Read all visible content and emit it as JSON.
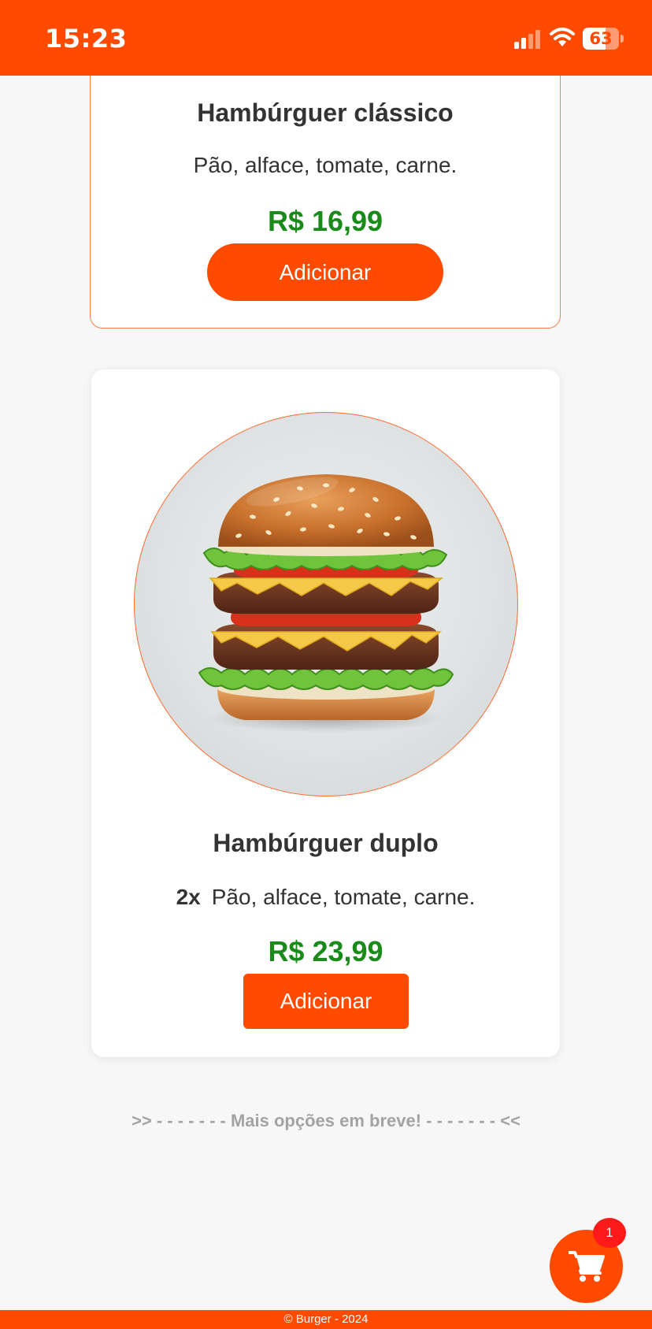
{
  "status_bar": {
    "time": "15:23",
    "battery_level": "63",
    "battery_fraction": 0.63,
    "signal_bars_filled": 2,
    "signal_bars_total": 4,
    "background_color": "#ff4a00"
  },
  "products": [
    {
      "title": "Hambúrguer clássico",
      "description": "Pão, alface, tomate, carne.",
      "price": "R$ 16,99",
      "add_label": "Adicionar"
    },
    {
      "title": "Hambúrguer duplo",
      "quantity": "2x",
      "description": "Pão, alface, tomate, carne.",
      "price": "R$ 23,99",
      "add_label": "Adicionar"
    }
  ],
  "more_options_text": ">> - - - - - - - Mais opções em breve! - - - - - - - <<",
  "cart": {
    "icon": "shopping-cart-icon",
    "count": "1"
  },
  "footer": {
    "text": "© Burger - 2024"
  },
  "colors": {
    "accent": "#ff4a00",
    "price": "#1a8a1a",
    "badge": "#ff1a1a",
    "background": "#f7f7f7"
  }
}
